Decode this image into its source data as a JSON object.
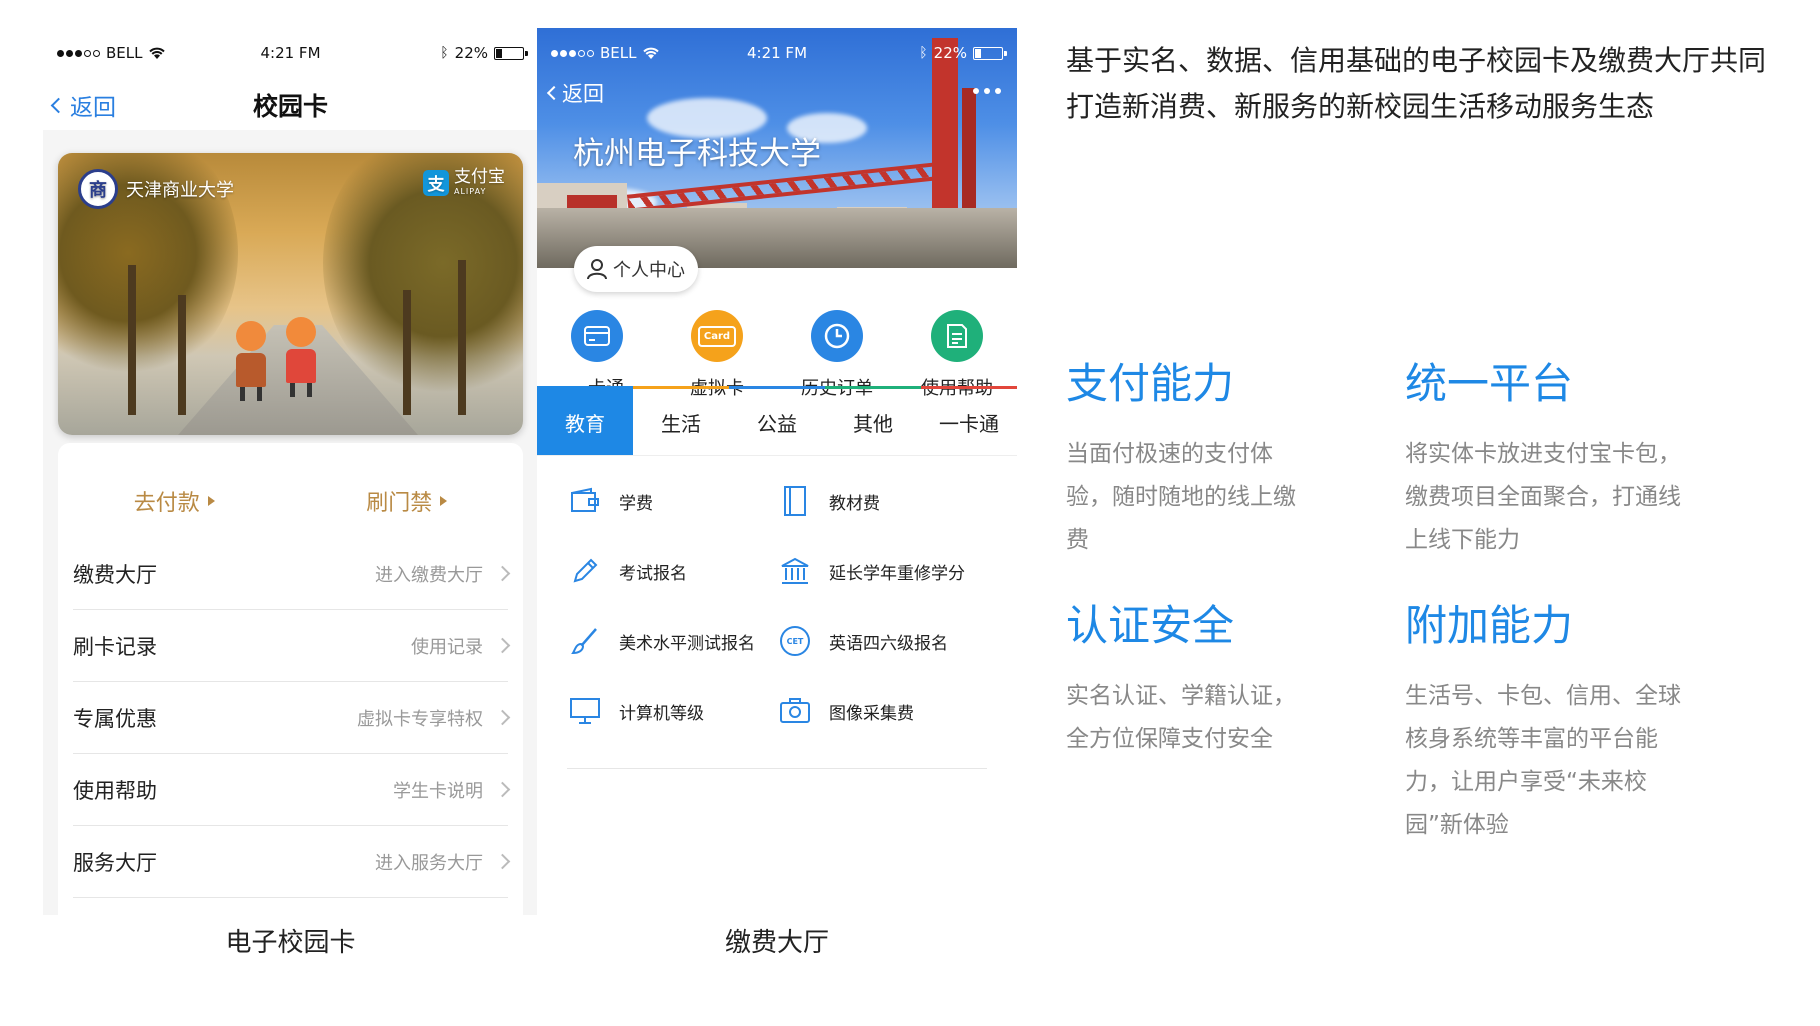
{
  "phone1": {
    "status": {
      "carrier": "BELL",
      "time": "4:21 FM",
      "battery": "22%"
    },
    "nav": {
      "back": "返回",
      "title": "校园卡"
    },
    "card": {
      "school": "天津商业大学",
      "emblem_char": "商",
      "alipay_char": "支",
      "alipay_name": "支付宝",
      "alipay_en": "ALIPAY"
    },
    "quick": [
      "去付款",
      "刷门禁"
    ],
    "rows": [
      {
        "label": "缴费大厅",
        "hint": "进入缴费大厅"
      },
      {
        "label": "刷卡记录",
        "hint": "使用记录"
      },
      {
        "label": "专属优惠",
        "hint": "虚拟卡专享特权"
      },
      {
        "label": "使用帮助",
        "hint": "学生卡说明"
      },
      {
        "label": "服务大厅",
        "hint": "进入服务大厅"
      }
    ],
    "caption": "电子校园卡"
  },
  "phone2": {
    "status": {
      "carrier": "BELL",
      "time": "4:21 FM",
      "battery": "22%"
    },
    "back": "返回",
    "title": "杭州电子科技大学",
    "personal": "个人中心",
    "icons": [
      {
        "label": "一卡通",
        "color": "#2a86e3",
        "icon": "card-icon"
      },
      {
        "label": "虚拟卡",
        "color": "#f5a21b",
        "icon": "virtual-card-icon",
        "badge": "Card"
      },
      {
        "label": "历史订单",
        "color": "#2a86e3",
        "icon": "clock-icon"
      },
      {
        "label": "使用帮助",
        "color": "#1fb07a",
        "icon": "help-doc-icon"
      }
    ],
    "tab_colors": [
      "#1e88e5",
      "#f5a21b",
      "#2a86e3",
      "#1fb07a",
      "#e2463b"
    ],
    "tabs": [
      "教育",
      "生活",
      "公益",
      "其他",
      "一卡通"
    ],
    "items": [
      {
        "label": "学费",
        "icon": "wallet-icon"
      },
      {
        "label": "教材费",
        "icon": "book-icon"
      },
      {
        "label": "考试报名",
        "icon": "pencil-icon"
      },
      {
        "label": "延长学年重修学分",
        "icon": "building-icon"
      },
      {
        "label": "美术水平测试报名",
        "icon": "brush-icon"
      },
      {
        "label": "英语四六级报名",
        "icon": "cet-icon",
        "badge": "CET"
      },
      {
        "label": "计算机等级",
        "icon": "monitor-icon"
      },
      {
        "label": "图像采集费",
        "icon": "camera-icon"
      }
    ],
    "caption": "缴费大厅"
  },
  "intro": "基于实名、数据、信用基础的电子校园卡及缴费大厅共同打造新消费、新服务的新校园生活移动服务生态",
  "features": [
    {
      "title": "支付能力",
      "text": "当面付极速的支付体验，随时随地的线上缴费"
    },
    {
      "title": "统一平台",
      "text": "将实体卡放进支付宝卡包，缴费项目全面聚合，打通线上线下能力"
    },
    {
      "title": "认证安全",
      "text": "实名认证、学籍认证，全方位保障支付安全"
    },
    {
      "title": "附加能力",
      "text": "生活号、卡包、信用、全球核身系统等丰富的平台能力，让用户享受“未来校园”新体验"
    }
  ],
  "colors": {
    "accent": "#1e88e5",
    "gold": "#b98a44",
    "muted": "#888888"
  }
}
